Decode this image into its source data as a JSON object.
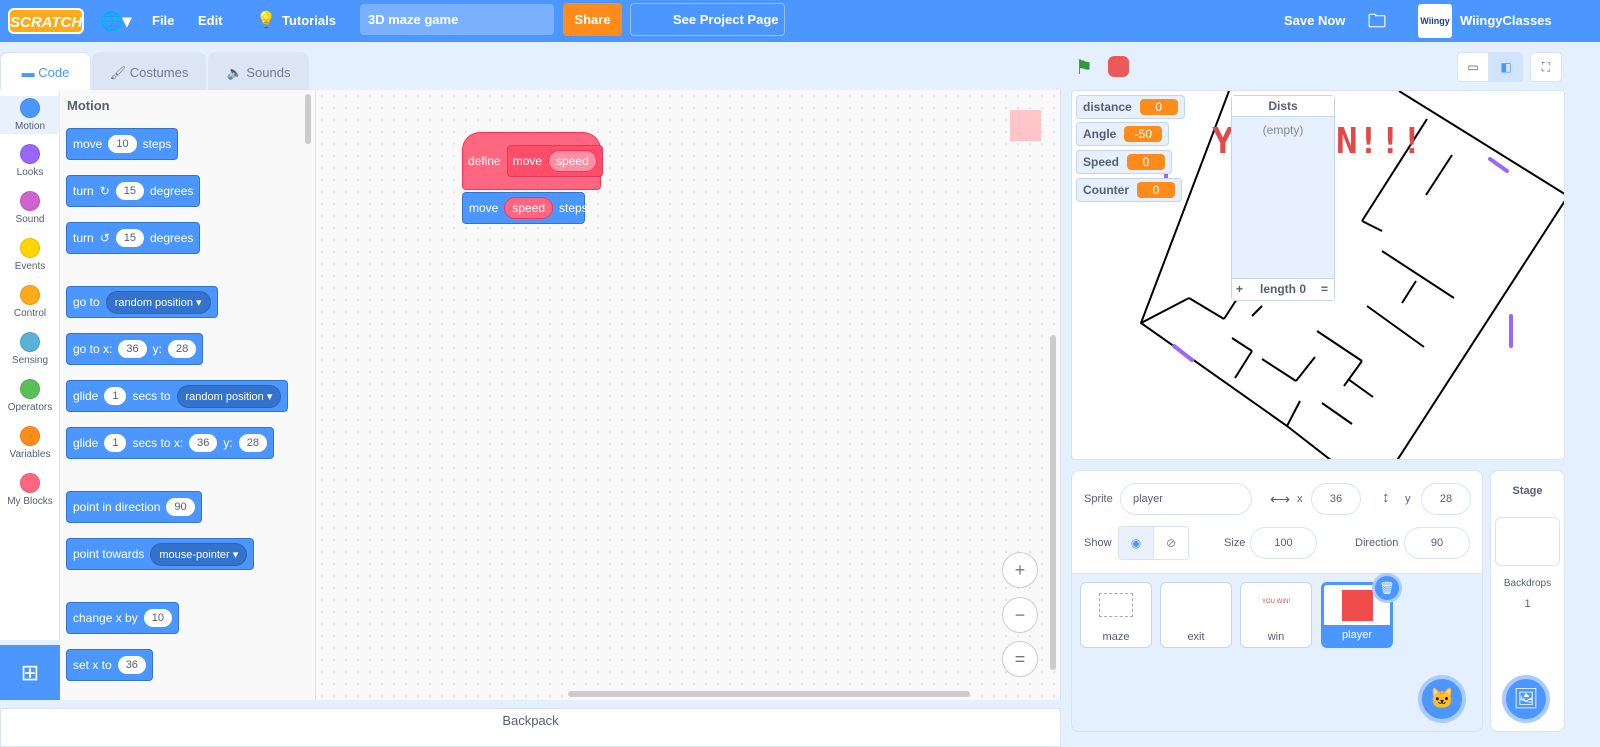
{
  "menubar": {
    "logo": "SCRATCH",
    "language_icon": "globe-icon",
    "file": "File",
    "edit": "Edit",
    "tutorials": "Tutorials",
    "project_title": "3D maze game",
    "share": "Share",
    "see_project_page": "See Project Page",
    "save_now": "Save Now",
    "user": "WiingyClasses",
    "avatar_text": "Wiingy"
  },
  "tabs": [
    {
      "label": "Code",
      "active": true
    },
    {
      "label": "Costumes"
    },
    {
      "label": "Sounds"
    }
  ],
  "categories": [
    {
      "label": "Motion",
      "color": "#4c97ff"
    },
    {
      "label": "Looks",
      "color": "#9966ff"
    },
    {
      "label": "Sound",
      "color": "#cf63cf"
    },
    {
      "label": "Events",
      "color": "#ffd500"
    },
    {
      "label": "Control",
      "color": "#ffab19"
    },
    {
      "label": "Sensing",
      "color": "#5cb1d6"
    },
    {
      "label": "Operators",
      "color": "#59c059"
    },
    {
      "label": "Variables",
      "color": "#ff8c1a"
    },
    {
      "label": "My Blocks",
      "color": "#ff6680"
    }
  ],
  "palette": {
    "title": "Motion",
    "blocks": {
      "move": [
        "move",
        "10",
        "steps"
      ],
      "turn_right": [
        "turn",
        "15",
        "degrees"
      ],
      "turn_left": [
        "turn",
        "15",
        "degrees"
      ],
      "goto": [
        "go to",
        "random position"
      ],
      "gotoxy": [
        "go to x:",
        "36",
        "y:",
        "28"
      ],
      "glide": [
        "glide",
        "1",
        "secs to",
        "random position"
      ],
      "glidexy": [
        "glide",
        "1",
        "secs to x:",
        "36",
        "y:",
        "28"
      ],
      "point_dir": [
        "point in direction",
        "90"
      ],
      "point_towards": [
        "point towards",
        "mouse-pointer"
      ],
      "change_x": [
        "change x by",
        "10"
      ],
      "set_x": [
        "set x to",
        "36"
      ]
    }
  },
  "script": {
    "define": "define",
    "proc_name": "move",
    "param": "speed",
    "move": "move",
    "move_arg": "speed",
    "steps": "steps"
  },
  "zoom": {
    "in": "+",
    "out": "−",
    "reset": "="
  },
  "backpack": "Backpack",
  "stage": {
    "monitors": [
      {
        "name": "distance",
        "value": "0"
      },
      {
        "name": "Angle",
        "value": "-50"
      },
      {
        "name": "Speed",
        "value": "0"
      },
      {
        "name": "Counter",
        "value": "0"
      }
    ],
    "list": {
      "name": "Dists",
      "empty": "(empty)",
      "add": "+",
      "length": "length 0",
      "resize": "="
    },
    "win_text_left": "Y",
    "win_text_right": "N!!!"
  },
  "sprite_info": {
    "sprite_label": "Sprite",
    "name": "player",
    "x_label": "x",
    "x": "36",
    "y_label": "y",
    "y": "28",
    "show_label": "Show",
    "size_label": "Size",
    "size": "100",
    "direction_label": "Direction",
    "direction": "90"
  },
  "sprites": [
    {
      "name": "maze"
    },
    {
      "name": "exit"
    },
    {
      "name": "win",
      "thumb_text": "YOU WIN!"
    },
    {
      "name": "player",
      "selected": true
    }
  ],
  "stage_selector": {
    "title": "Stage",
    "backdrops_label": "Backdrops",
    "backdrops": "1"
  }
}
